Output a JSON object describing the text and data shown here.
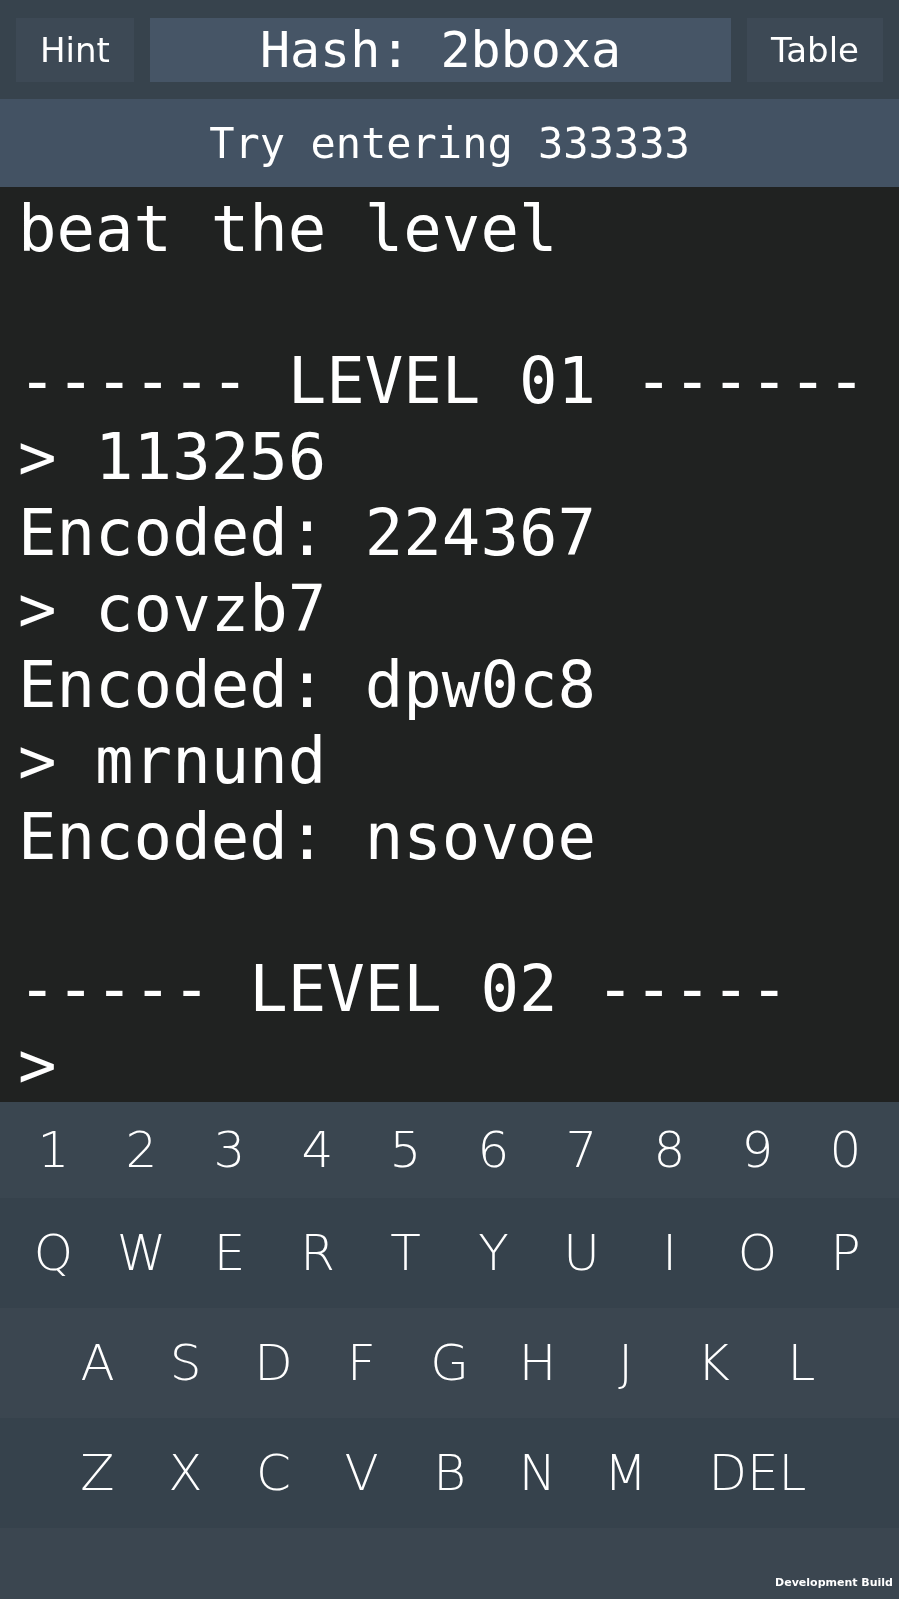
{
  "header": {
    "hint_button": "Hint",
    "hash": "Hash: 2bboxa",
    "table_button": "Table"
  },
  "hint_message": "Try entering 333333",
  "terminal": [
    {
      "kind": "text",
      "text": "beat the level"
    },
    {
      "kind": "blank"
    },
    {
      "kind": "text",
      "text": "------ LEVEL 01 ------"
    },
    {
      "kind": "text",
      "text": "> 113256"
    },
    {
      "kind": "text",
      "text": "Encoded: 224367"
    },
    {
      "kind": "text",
      "text": "> covzb7"
    },
    {
      "kind": "text",
      "text": "Encoded: dpw0c8"
    },
    {
      "kind": "text",
      "text": "> mrnund"
    },
    {
      "kind": "text",
      "text": "Encoded: nsovoe"
    },
    {
      "kind": "blank"
    },
    {
      "kind": "text",
      "text": "----- LEVEL 02 -----"
    },
    {
      "kind": "text",
      "text": ">"
    }
  ],
  "keyboard": [
    [
      "1",
      "2",
      "3",
      "4",
      "5",
      "6",
      "7",
      "8",
      "9",
      "0"
    ],
    [
      "Q",
      "W",
      "E",
      "R",
      "T",
      "Y",
      "U",
      "I",
      "O",
      "P"
    ],
    [
      "A",
      "S",
      "D",
      "F",
      "G",
      "H",
      "J",
      "K",
      "L"
    ],
    [
      "Z",
      "X",
      "C",
      "V",
      "B",
      "N",
      "M",
      "DEL"
    ]
  ],
  "build_label": "Development Build"
}
